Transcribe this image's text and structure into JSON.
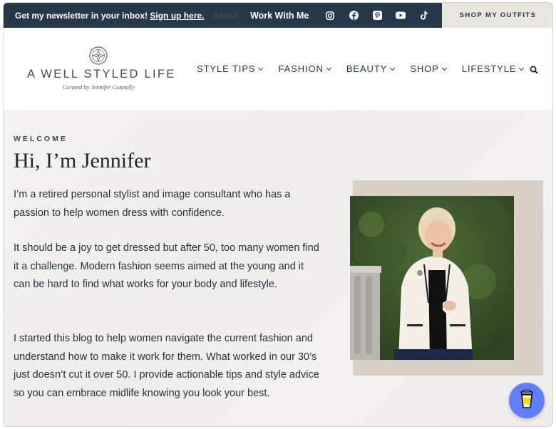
{
  "topbar": {
    "newsletter_text": "Get my newsletter in your inbox!",
    "newsletter_link": "Sign up here.",
    "about": "About",
    "work_with_me": "Work With Me",
    "social_icons": [
      "instagram-icon",
      "facebook-icon",
      "pinterest-icon",
      "youtube-icon",
      "tiktok-icon"
    ],
    "shop_button": "SHOP MY OUTFITS"
  },
  "logo": {
    "title": "A WELL STYLED LIFE",
    "tagline": "Curated by Jennifer Connolly"
  },
  "nav": {
    "items": [
      {
        "label": "STYLE TIPS"
      },
      {
        "label": "FASHION"
      },
      {
        "label": "BEAUTY"
      },
      {
        "label": "SHOP"
      },
      {
        "label": "LIFESTYLE"
      }
    ],
    "search_icon": "search-icon"
  },
  "welcome": {
    "eyebrow": "WELCOME",
    "heading": "Hi, I’m Jennifer",
    "paragraph1": "I’m a retired personal stylist and image consultant who has a passion to help women dress with confidence.",
    "paragraph2": "It should be a joy to get dressed but after 50, too many women find it a challenge. Modern fashion seems aimed at the young and it can be hard to find what works for your body and lifestyle.",
    "paragraph3": "I started this blog to help women navigate the current fashion and understand how to make it work for them. What worked in our 30’s just doesn’t cut it over 50. I provide actionable tips and style advice so you can embrace midlife knowing you look your best."
  },
  "colors": {
    "topbar": "#26384a",
    "shop_button_bg": "#e9e5e1",
    "photo_backdrop": "#dacfc4",
    "coffee_button": "#5f7fff"
  },
  "floating": {
    "coffee_icon": "coffee-cup-icon"
  }
}
